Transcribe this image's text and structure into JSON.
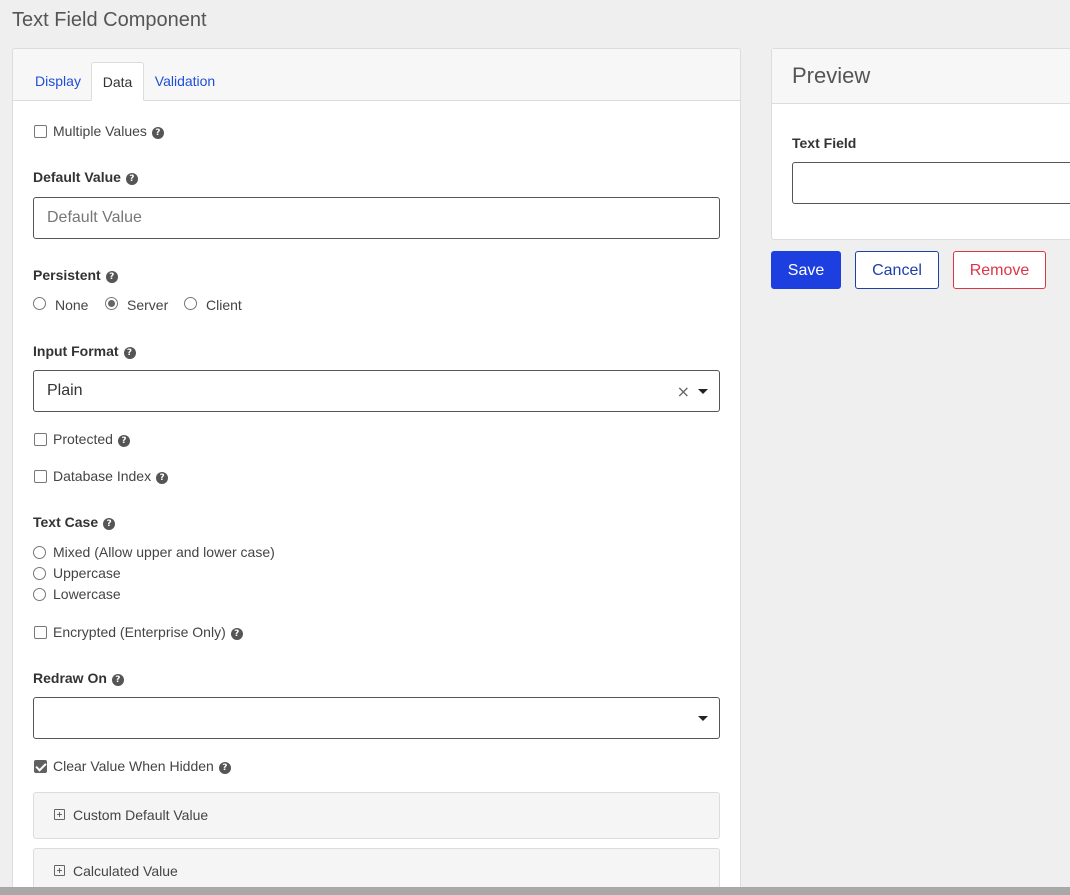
{
  "page": {
    "title": "Text Field Component"
  },
  "tabs": [
    {
      "label": "Display",
      "active": false
    },
    {
      "label": "Data",
      "active": true
    },
    {
      "label": "Validation",
      "active": false
    }
  ],
  "form": {
    "multiple_values": {
      "label": "Multiple Values",
      "checked": false
    },
    "default_value": {
      "label": "Default Value",
      "placeholder": "Default Value",
      "value": ""
    },
    "persistent": {
      "label": "Persistent",
      "options": [
        "None",
        "Server",
        "Client"
      ],
      "selected": "Server"
    },
    "input_format": {
      "label": "Input Format",
      "value": "Plain"
    },
    "protected": {
      "label": "Protected",
      "checked": false
    },
    "database_index": {
      "label": "Database Index",
      "checked": false
    },
    "text_case": {
      "label": "Text Case",
      "options": [
        "Mixed (Allow upper and lower case)",
        "Uppercase",
        "Lowercase"
      ],
      "selected": ""
    },
    "encrypted": {
      "label": "Encrypted (Enterprise Only)",
      "checked": false
    },
    "redraw_on": {
      "label": "Redraw On",
      "value": ""
    },
    "clear_value_when_hidden": {
      "label": "Clear Value When Hidden",
      "checked": true
    },
    "panels": [
      "Custom Default Value",
      "Calculated Value"
    ]
  },
  "preview": {
    "title": "Preview",
    "field_label": "Text Field",
    "field_value": ""
  },
  "actions": {
    "save": "Save",
    "cancel": "Cancel",
    "remove": "Remove"
  },
  "icons": {
    "help": "question-circle-icon",
    "expand": "plus-square-icon",
    "clear": "x-icon",
    "dropdown": "caret-down-icon"
  },
  "colors": {
    "primary": "#1d3fe0",
    "cancel": "#1d3fa8",
    "danger": "#dc3545",
    "link": "#1d4ed8"
  }
}
